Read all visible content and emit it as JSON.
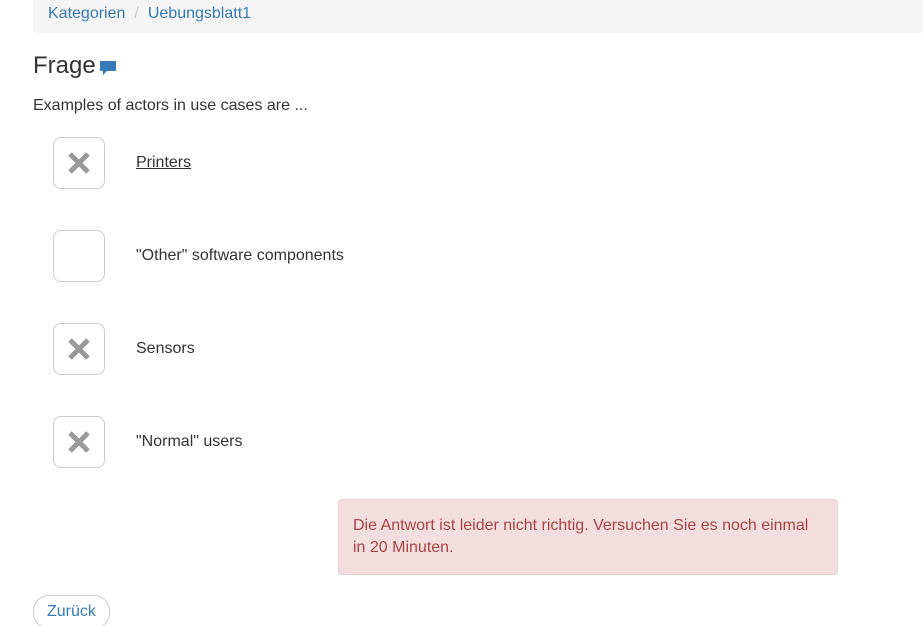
{
  "breadcrumb": {
    "items": [
      {
        "label": "Kategorien"
      },
      {
        "label": "Uebungsblatt1"
      }
    ],
    "separator": "/"
  },
  "header": {
    "title": "Frage",
    "comment_icon": "comment-bubble-icon"
  },
  "question": {
    "text": "Examples of actors in use cases are ..."
  },
  "options": [
    {
      "label": "Printers",
      "checked": true,
      "mark_icon": "x-mark-icon"
    },
    {
      "label": "\"Other\" software components",
      "checked": false
    },
    {
      "label": "Sensors",
      "checked": true,
      "mark_icon": "x-mark-icon"
    },
    {
      "label": "\"Normal\" users",
      "checked": true,
      "mark_icon": "x-mark-icon"
    }
  ],
  "alert": {
    "message": "Die Antwort ist leider nicht richtig. Versuchen Sie es noch einmal in 20 Minuten."
  },
  "footer": {
    "back_label": "Zurück"
  },
  "colors": {
    "link": "#337ab7",
    "alert_bg": "#f2dede",
    "alert_text": "#a94442",
    "mark": "#999999"
  }
}
